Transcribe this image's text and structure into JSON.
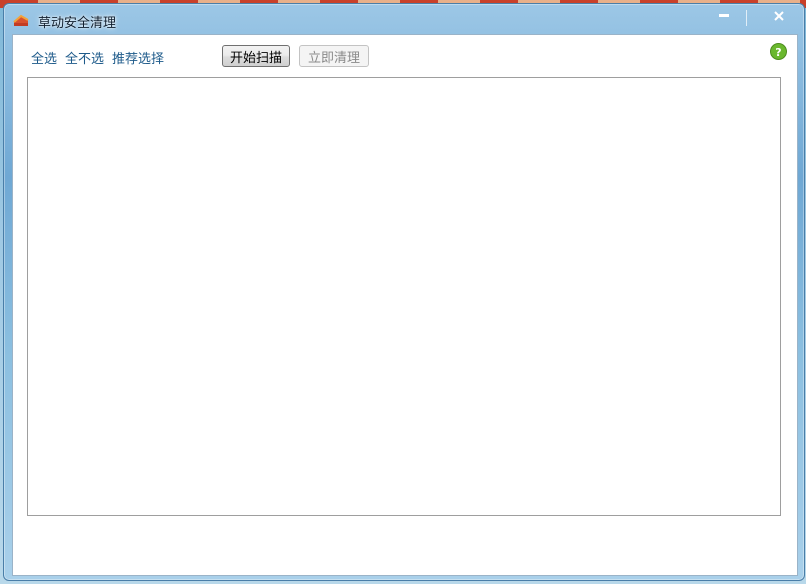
{
  "window": {
    "title": "草动安全清理",
    "app_icon": "app-logo-icon",
    "minimize_icon": "minimize-icon",
    "close_icon": "close-icon"
  },
  "toolbar": {
    "select_all": "全选",
    "select_none": "全不选",
    "recommended_select": "推荐选择",
    "scan_button": "开始扫描",
    "clean_button": "立即清理",
    "help_icon": "help-icon"
  },
  "colors": {
    "link": "#1d5a8a",
    "help_green": "#6ab82e"
  }
}
